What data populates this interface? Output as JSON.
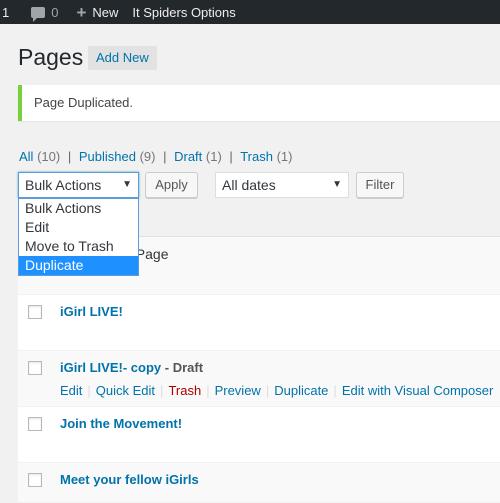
{
  "admin_bar": {
    "updates_count": "1",
    "comments_count": "0",
    "new_label": "New",
    "plugin_label": "It Spiders Options"
  },
  "header": {
    "title": "Pages",
    "add_new_label": "Add New"
  },
  "notice": {
    "message": "Page Duplicated.",
    "accent_color": "#7ad03a"
  },
  "filters": {
    "all": {
      "label": "All",
      "count": "(10)"
    },
    "published": {
      "label": "Published",
      "count": "(9)"
    },
    "draft": {
      "label": "Draft",
      "count": "(1)"
    },
    "trash": {
      "label": "Trash",
      "count": "(1)"
    },
    "separator": "|"
  },
  "toolbar": {
    "bulk_actions_value": "Bulk Actions",
    "apply_label": "Apply",
    "dates_value": "All dates",
    "filter_label": "Filter"
  },
  "bulk_dropdown": {
    "options": [
      "Bulk Actions",
      "Edit",
      "Move to Trash",
      "Duplicate"
    ],
    "selected": "Duplicate"
  },
  "partial_row_title": "t Page",
  "rows": [
    {
      "title": "iGirl LIVE!"
    },
    {
      "title": "iGirl LIVE!- copy",
      "state": "- Draft",
      "actions": [
        "Edit",
        "Quick Edit",
        "Trash",
        "Preview",
        "Duplicate",
        "Edit with Visual Composer"
      ]
    },
    {
      "title": "Join the Movement!"
    },
    {
      "title": "Meet your fellow iGirls"
    }
  ]
}
